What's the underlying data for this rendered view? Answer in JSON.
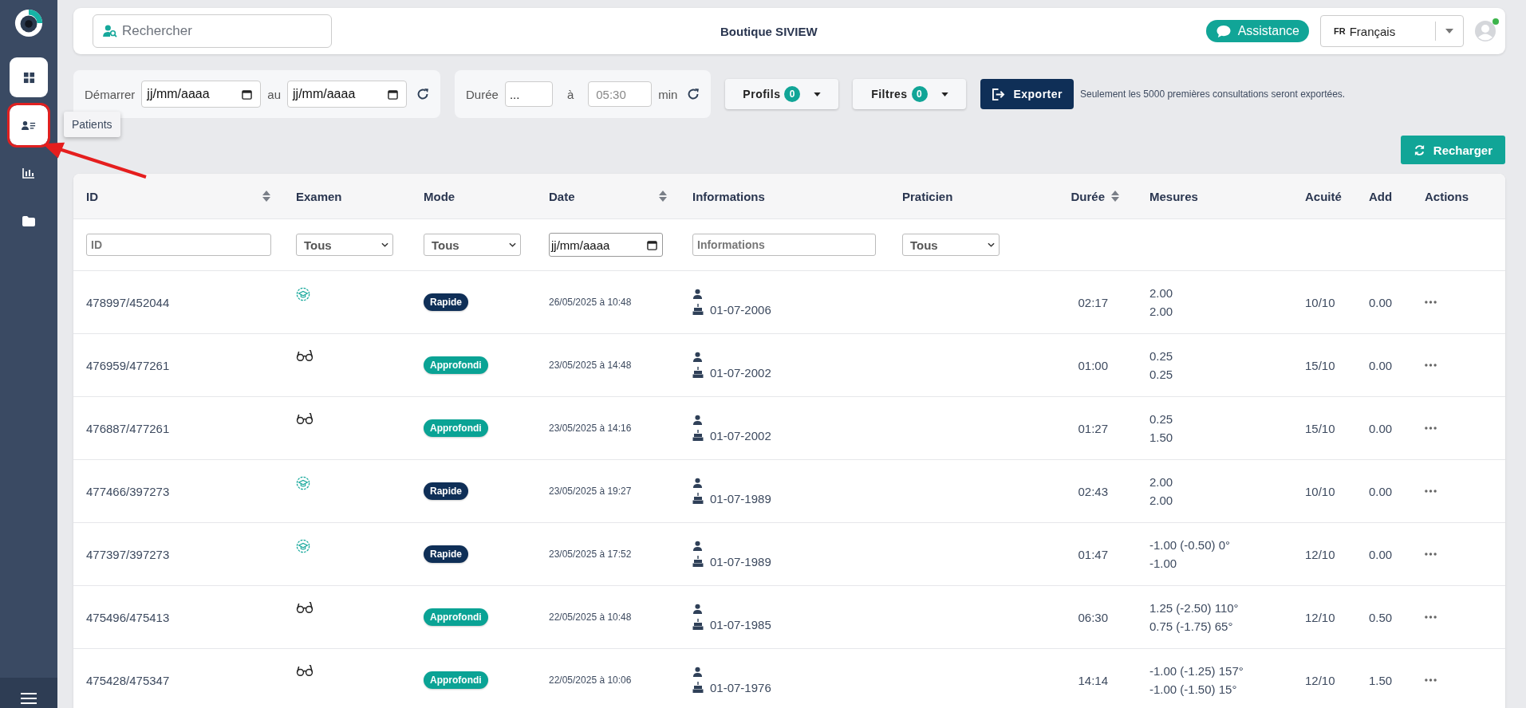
{
  "sidebar": {
    "items": [
      {
        "kind": "dashboard",
        "selected": true,
        "highlighted": false
      },
      {
        "kind": "patients",
        "selected": true,
        "highlighted": true,
        "tooltip": "Patients"
      },
      {
        "kind": "chart",
        "selected": false,
        "highlighted": false
      },
      {
        "kind": "folder",
        "selected": false,
        "highlighted": false
      }
    ]
  },
  "topbar": {
    "search": {
      "placeholder": "Rechercher"
    },
    "title": "Boutique SIVIEW",
    "assistance": "Assistance",
    "language": {
      "code": "FR",
      "label": "Français"
    },
    "user": {
      "online": true
    }
  },
  "filters": {
    "start_label": "Démarrer",
    "start": "jj/mm/aaaa",
    "between": "au",
    "end": "jj/mm/aaaa",
    "duration_label": "Durée",
    "duration_from": "...",
    "duration_to_label": "à",
    "duration_to_placeholder": "05:30",
    "duration_unit": "min",
    "profiles": {
      "label": "Profils",
      "count": "0"
    },
    "filters": {
      "label": "Filtres",
      "count": "0"
    },
    "export": "Exporter",
    "export_note": "Seulement les 5000 premières consultations seront exportées."
  },
  "reload": "Recharger",
  "table": {
    "columns": [
      {
        "label": "ID",
        "sortable": true,
        "filter": {
          "kind": "text",
          "placeholder": "ID"
        }
      },
      {
        "label": "Examen",
        "sortable": false,
        "filter": {
          "kind": "select",
          "value": "Tous"
        }
      },
      {
        "label": "Mode",
        "sortable": false,
        "filter": {
          "kind": "select",
          "value": "Tous"
        }
      },
      {
        "label": "Date",
        "sortable": true,
        "filter": {
          "kind": "date",
          "value": "jj/mm/aaaa"
        }
      },
      {
        "label": "Informations",
        "sortable": false,
        "filter": {
          "kind": "text",
          "placeholder": "Informations"
        }
      },
      {
        "label": "Praticien",
        "sortable": false,
        "filter": {
          "kind": "select",
          "value": "Tous"
        }
      },
      {
        "label": "Durée",
        "sortable": true
      },
      {
        "label": "Mesures",
        "sortable": false
      },
      {
        "label": "Acuité",
        "sortable": false
      },
      {
        "label": "Add",
        "sortable": false
      },
      {
        "label": "Actions",
        "sortable": false
      }
    ],
    "rows": [
      {
        "id": "478997/452044",
        "kind": "graduate",
        "mode": {
          "label": "Rapide",
          "color": "#0f2f57"
        },
        "date": "26/05/2025 à 10:48",
        "birth": "01-07-2006",
        "duration": "02:17",
        "measures": [
          "2.00",
          "2.00"
        ],
        "acuity": "10/10",
        "add": "0.00"
      },
      {
        "id": "476959/477261",
        "kind": "glasses",
        "mode": {
          "label": "Approfondi",
          "color": "#0aa395"
        },
        "date": "23/05/2025 à 14:48",
        "birth": "01-07-2002",
        "duration": "01:00",
        "measures": [
          "0.25",
          "0.25"
        ],
        "acuity": "15/10",
        "add": "0.00"
      },
      {
        "id": "476887/477261",
        "kind": "glasses",
        "mode": {
          "label": "Approfondi",
          "color": "#0aa395"
        },
        "date": "23/05/2025 à 14:16",
        "birth": "01-07-2002",
        "duration": "01:27",
        "measures": [
          "0.25",
          "1.50"
        ],
        "acuity": "15/10",
        "add": "0.00"
      },
      {
        "id": "477466/397273",
        "kind": "graduate",
        "mode": {
          "label": "Rapide",
          "color": "#0f2f57"
        },
        "date": "23/05/2025 à 19:27",
        "birth": "01-07-1989",
        "duration": "02:43",
        "measures": [
          "2.00",
          "2.00"
        ],
        "acuity": "10/10",
        "add": "0.00"
      },
      {
        "id": "477397/397273",
        "kind": "graduate",
        "mode": {
          "label": "Rapide",
          "color": "#0f2f57"
        },
        "date": "23/05/2025 à 17:52",
        "birth": "01-07-1989",
        "duration": "01:47",
        "measures": [
          "-1.00 (-0.50) 0°",
          "-1.00"
        ],
        "acuity": "12/10",
        "add": "0.00"
      },
      {
        "id": "475496/475413",
        "kind": "glasses",
        "mode": {
          "label": "Approfondi",
          "color": "#0aa395"
        },
        "date": "22/05/2025 à 10:48",
        "birth": "01-07-1985",
        "duration": "06:30",
        "measures": [
          "1.25 (-2.50) 110°",
          "0.75 (-1.75) 65°"
        ],
        "acuity": "12/10",
        "add": "0.50"
      },
      {
        "id": "475428/475347",
        "kind": "glasses",
        "mode": {
          "label": "Approfondi",
          "color": "#0aa395"
        },
        "date": "22/05/2025 à 10:06",
        "birth": "01-07-1976",
        "duration": "14:14",
        "measures": [
          "-1.00 (-1.25) 157°",
          "-1.00 (-1.50) 15°"
        ],
        "acuity": "12/10",
        "add": "1.50"
      }
    ]
  }
}
